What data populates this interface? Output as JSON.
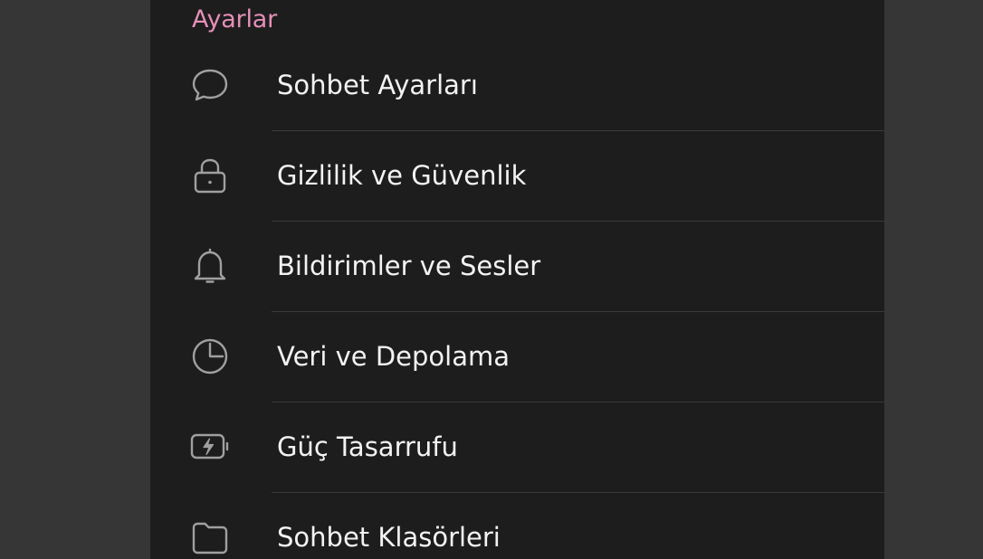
{
  "section": {
    "title": "Ayarlar"
  },
  "items": [
    {
      "label": "Sohbet Ayarları",
      "icon": "chat-bubble-icon"
    },
    {
      "label": "Gizlilik ve Güvenlik",
      "icon": "lock-icon"
    },
    {
      "label": "Bildirimler ve Sesler",
      "icon": "bell-icon"
    },
    {
      "label": "Veri ve Depolama",
      "icon": "pie-chart-icon"
    },
    {
      "label": "Güç Tasarrufu",
      "icon": "battery-charging-icon"
    },
    {
      "label": "Sohbet Klasörleri",
      "icon": "folder-icon"
    }
  ],
  "colors": {
    "background": "#363636",
    "panel": "#1d1d1d",
    "accent": "#e58fb8",
    "text": "#f3f3f3",
    "icon": "#a0a0a0",
    "divider": "#3a3a3a"
  }
}
